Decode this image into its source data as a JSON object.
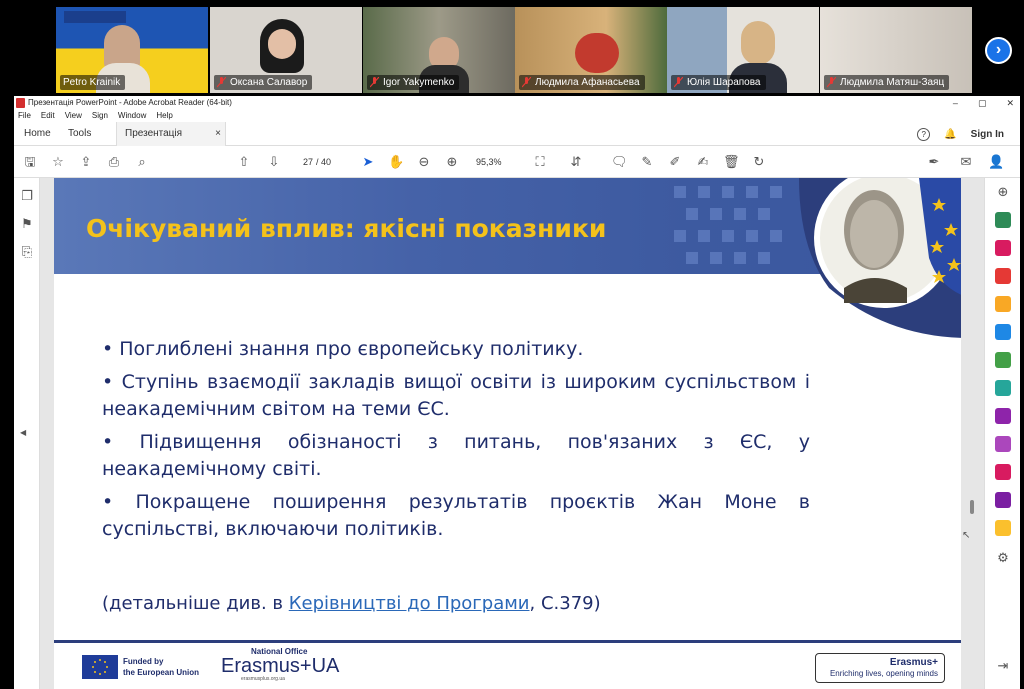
{
  "meeting": {
    "participants": [
      {
        "name": "Petro Krainik",
        "muted": false,
        "active": true
      },
      {
        "name": "Оксана Салавор",
        "muted": true
      },
      {
        "name": "Igor Yakymenko",
        "muted": true
      },
      {
        "name": "Людмила Афанасьева",
        "muted": true
      },
      {
        "name": "Юлія Шарапова",
        "muted": true
      },
      {
        "name": "Людмила Матяш-Заяц",
        "muted": true
      }
    ],
    "next_icon": "chevron-right-icon"
  },
  "window": {
    "title": "Презентація PowerPoint - Adobe Acrobat Reader (64-bit)",
    "controls": [
      "–",
      "▢",
      "✕"
    ]
  },
  "menu": [
    "File",
    "Edit",
    "View",
    "Sign",
    "Window",
    "Help"
  ],
  "tabs": {
    "home": "Home",
    "tools": "Tools",
    "doc": "Презентація Power...",
    "close": "×",
    "sign_in": "Sign In"
  },
  "toolbar": {
    "page_current": "27",
    "page_total": "/ 40",
    "zoom": "95,3%"
  },
  "slide": {
    "title": "Очікуваний вплив: якісні показники",
    "bullets": [
      "• Поглиблені знання про європейську політику.",
      "• Ступінь взаємодії закладів вищої освіти із широким суспільством і неакадемічним світом на теми ЄС.",
      "• Підвищення обізнаності з питань, пов'язаних з ЄС, у неакадемічному світі.",
      "• Покращене поширення результатів проєктів Жан Моне в суспільстві, включаючи політиків."
    ],
    "note_prefix": "(детальніше див. в ",
    "note_link": "Керівництві до Програми",
    "note_suffix": ", С.379)",
    "footer": {
      "funded_line1": "Funded by",
      "funded_line2": "the European Union",
      "national_office": "National Office",
      "erasmus_ua": "Erasmus+UA",
      "erasmus_url": "erasmusplus.org.ua",
      "erasmus_plus": "Erasmus+",
      "tagline": "Enriching lives, opening minds"
    }
  },
  "colors": {
    "title_yellow": "#f4c21b",
    "header_blue": "#4562a8",
    "text_navy": "#1f2d6b",
    "link_blue": "#2a68b8",
    "active_tile": "#38d38a",
    "next_btn": "#1a73e8"
  }
}
